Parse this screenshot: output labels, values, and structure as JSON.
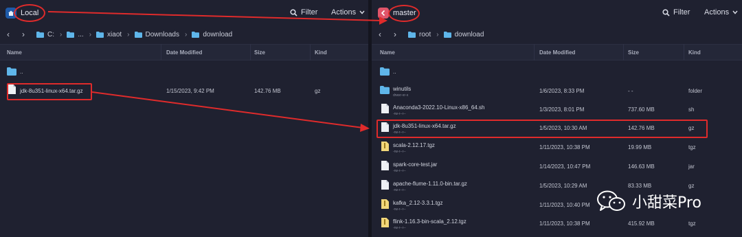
{
  "left": {
    "host": "Local",
    "filter_label": "Filter",
    "actions_label": "Actions",
    "breadcrumbs": [
      "C:",
      "...",
      "xiaot",
      "Downloads",
      "download"
    ],
    "columns": {
      "name": "Name",
      "modified": "Date Modified",
      "size": "Size",
      "kind": "Kind"
    },
    "files": [
      {
        "name": "..",
        "perm": "",
        "modified": "",
        "size": "",
        "kind": "",
        "icon": "folder-icon"
      },
      {
        "name": "jdk-8u351-linux-x64.tar.gz",
        "perm": "",
        "modified": "1/15/2023, 9:42 PM",
        "size": "142.76 MB",
        "kind": "gz",
        "icon": "file-icon"
      }
    ]
  },
  "right": {
    "host": "master",
    "filter_label": "Filter",
    "actions_label": "Actions",
    "breadcrumbs": [
      "root",
      "download"
    ],
    "columns": {
      "name": "Name",
      "modified": "Date Modified",
      "size": "Size",
      "kind": "Kind"
    },
    "files": [
      {
        "name": "..",
        "perm": "",
        "modified": "",
        "size": "",
        "kind": "",
        "icon": "folder-icon"
      },
      {
        "name": "winutils",
        "perm": "drwxr-xr-x",
        "modified": "1/6/2023, 8:33 PM",
        "size": "- -",
        "kind": "folder",
        "icon": "folder-icon"
      },
      {
        "name": "Anaconda3-2022.10-Linux-x86_64.sh",
        "perm": "-rw-r--r--",
        "modified": "1/3/2023, 8:01 PM",
        "size": "737.60 MB",
        "kind": "sh",
        "icon": "file-icon"
      },
      {
        "name": "jdk-8u351-linux-x64.tar.gz",
        "perm": "-rw-r--r--",
        "modified": "1/5/2023, 10:30 AM",
        "size": "142.76 MB",
        "kind": "gz",
        "icon": "file-icon"
      },
      {
        "name": "scala-2.12.17.tgz",
        "perm": "-rw-r--r--",
        "modified": "1/11/2023, 10:38 PM",
        "size": "19.99 MB",
        "kind": "tgz",
        "icon": "archive-icon"
      },
      {
        "name": "spark-core-test.jar",
        "perm": "-rw-r--r--",
        "modified": "1/14/2023, 10:47 PM",
        "size": "146.63 MB",
        "kind": "jar",
        "icon": "file-icon"
      },
      {
        "name": "apache-flume-1.11.0-bin.tar.gz",
        "perm": "-rw-r--r--",
        "modified": "1/5/2023, 10:29 AM",
        "size": "83.33 MB",
        "kind": "gz",
        "icon": "file-icon"
      },
      {
        "name": "kafka_2.12-3.3.1.tgz",
        "perm": "-rw-r--r--",
        "modified": "1/11/2023, 10:40 PM",
        "size": "",
        "kind": "",
        "icon": "archive-icon"
      },
      {
        "name": "flink-1.16.3-bin-scala_2.12.tgz",
        "perm": "-rw-r--r--",
        "modified": "1/11/2023, 10:38 PM",
        "size": "415.92 MB",
        "kind": "tgz",
        "icon": "archive-icon"
      }
    ]
  },
  "watermark": {
    "text": "小甜菜Pro",
    "icon": "wechat-icon"
  },
  "colors": {
    "annotation": "#e02b2b",
    "folder": "#5fb6ea",
    "master_badge": "#e0556a",
    "local_badge": "#4a8fd8"
  }
}
